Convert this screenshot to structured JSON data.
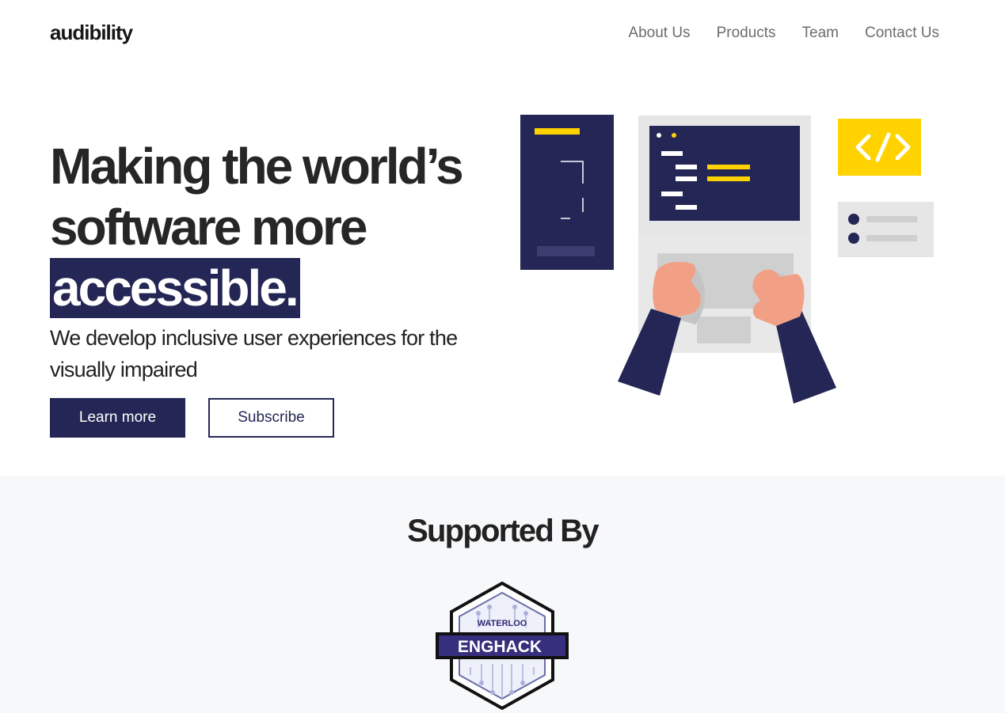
{
  "header": {
    "logo": "audibility",
    "nav": [
      "About Us",
      "Products",
      "Team",
      "Contact Us"
    ]
  },
  "hero": {
    "title_line1": "Making the world’s",
    "title_line2": "software more",
    "title_highlight": "accessible.",
    "subtitle": "We develop inclusive user experiences for the visually impaired",
    "primary_button": "Learn more",
    "secondary_button": "Subscribe"
  },
  "supported": {
    "heading": "Supported By",
    "badge_top": "WATERLOO",
    "badge_main": "ENGHACK"
  },
  "colors": {
    "navy": "#242755",
    "yellow": "#FFD200",
    "skin": "#F2A085",
    "light_gray": "#E6E6E6",
    "section_bg": "#F7F8FA"
  },
  "icons": [
    "code-icon",
    "laptop-illustration",
    "phone-illustration",
    "list-card-icon",
    "enghack-badge"
  ]
}
